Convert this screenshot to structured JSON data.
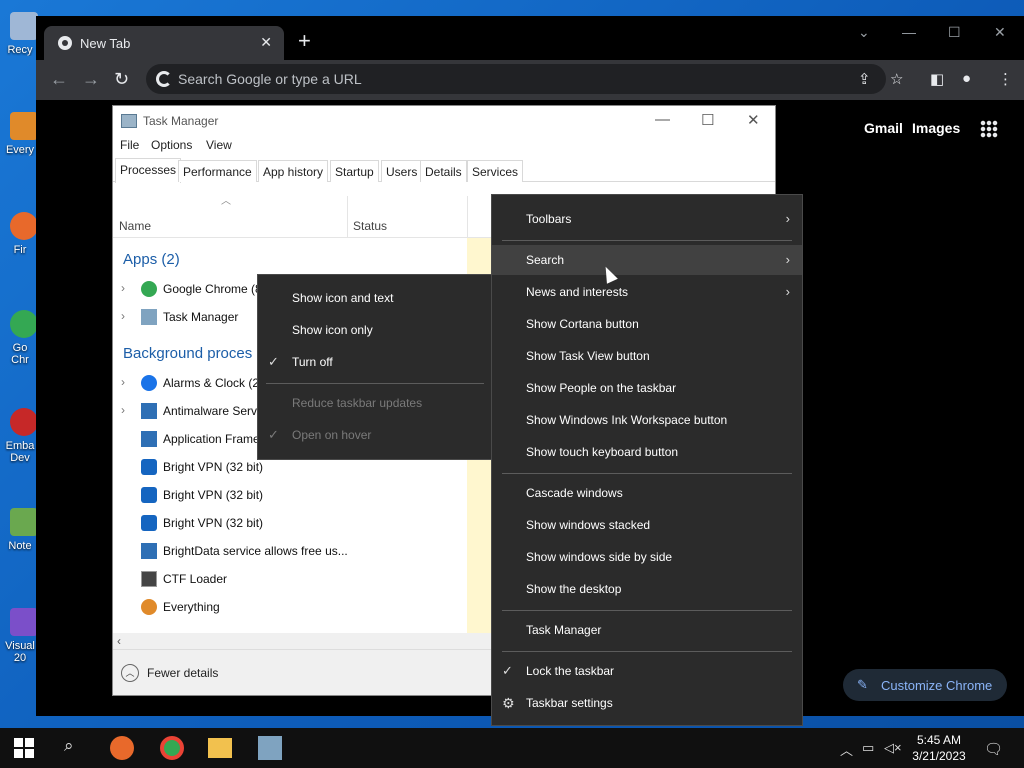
{
  "desktop": {
    "icons": [
      {
        "label": "Recy",
        "color": "#9fb7d6"
      },
      {
        "label": "Every",
        "color": "#e08a2a"
      },
      {
        "label": "Fir",
        "color": "#e8692b"
      },
      {
        "label": "Go\nChr",
        "color": "#34a853"
      },
      {
        "label": "Emba\nDev",
        "color": "#c62828"
      },
      {
        "label": "Note",
        "color": "#6aa84f"
      },
      {
        "label": "Visual\n20",
        "color": "#7b4fc9"
      }
    ]
  },
  "chrome": {
    "tab_title": "New Tab",
    "omnibox_placeholder": "Search Google or type a URL",
    "gmail": "Gmail",
    "images": "Images",
    "customize": "Customize Chrome"
  },
  "task_manager": {
    "title": "Task Manager",
    "menu": [
      "File",
      "Options",
      "View"
    ],
    "tabs": [
      "Processes",
      "Performance",
      "App history",
      "Startup",
      "Users",
      "Details",
      "Services"
    ],
    "columns": {
      "name": "Name",
      "status": "Status"
    },
    "groups": {
      "apps": "Apps (2)",
      "background": "Background proces"
    },
    "apps": [
      {
        "name": "Google Chrome (8",
        "expandable": true,
        "icon_color": "#34a853"
      },
      {
        "name": "Task Manager",
        "expandable": true,
        "icon_color": "#7fa3c0"
      }
    ],
    "background": [
      {
        "name": "Alarms & Clock (2",
        "expandable": true,
        "icon_color": "#1a73e8"
      },
      {
        "name": "Antimalware Serv",
        "expandable": true,
        "icon_color": "#2e6fb5"
      },
      {
        "name": "Application Frame",
        "expandable": false,
        "icon_color": "#2e6fb5"
      },
      {
        "name": "Bright VPN (32 bit)",
        "expandable": false,
        "icon_color": "#1565c0"
      },
      {
        "name": "Bright VPN (32 bit)",
        "expandable": false,
        "icon_color": "#1565c0"
      },
      {
        "name": "Bright VPN (32 bit)",
        "expandable": false,
        "icon_color": "#1565c0"
      },
      {
        "name": "BrightData service allows free us...",
        "expandable": false,
        "icon_color": "#2e6fb5"
      },
      {
        "name": "CTF Loader",
        "expandable": false,
        "icon_color": "#444444"
      },
      {
        "name": "Everything",
        "expandable": false,
        "icon_color": "#e08a2a"
      }
    ],
    "fewer_details": "Fewer details"
  },
  "search_submenu": {
    "items": [
      {
        "label": "Show icon and text",
        "checked": false,
        "disabled": false
      },
      {
        "label": "Show icon only",
        "checked": false,
        "disabled": false
      },
      {
        "label": "Turn off",
        "checked": true,
        "disabled": false
      },
      {
        "label": "Reduce taskbar updates",
        "checked": false,
        "disabled": true
      },
      {
        "label": "Open on hover",
        "checked": true,
        "disabled": true
      }
    ]
  },
  "taskbar_menu": {
    "items": [
      {
        "label": "Toolbars",
        "arrow": true
      },
      {
        "label": "Search",
        "arrow": true,
        "highlighted": true
      },
      {
        "label": "News and interests",
        "arrow": true
      },
      {
        "label": "Show Cortana button"
      },
      {
        "label": "Show Task View button"
      },
      {
        "label": "Show People on the taskbar"
      },
      {
        "label": "Show Windows Ink Workspace button"
      },
      {
        "label": "Show touch keyboard button"
      },
      {
        "label": "Cascade windows"
      },
      {
        "label": "Show windows stacked"
      },
      {
        "label": "Show windows side by side"
      },
      {
        "label": "Show the desktop"
      },
      {
        "label": "Task Manager"
      },
      {
        "label": "Lock the taskbar",
        "checked": true
      },
      {
        "label": "Taskbar settings",
        "gear": true
      }
    ]
  },
  "taskbar": {
    "time": "5:45 AM",
    "date": "3/21/2023"
  }
}
